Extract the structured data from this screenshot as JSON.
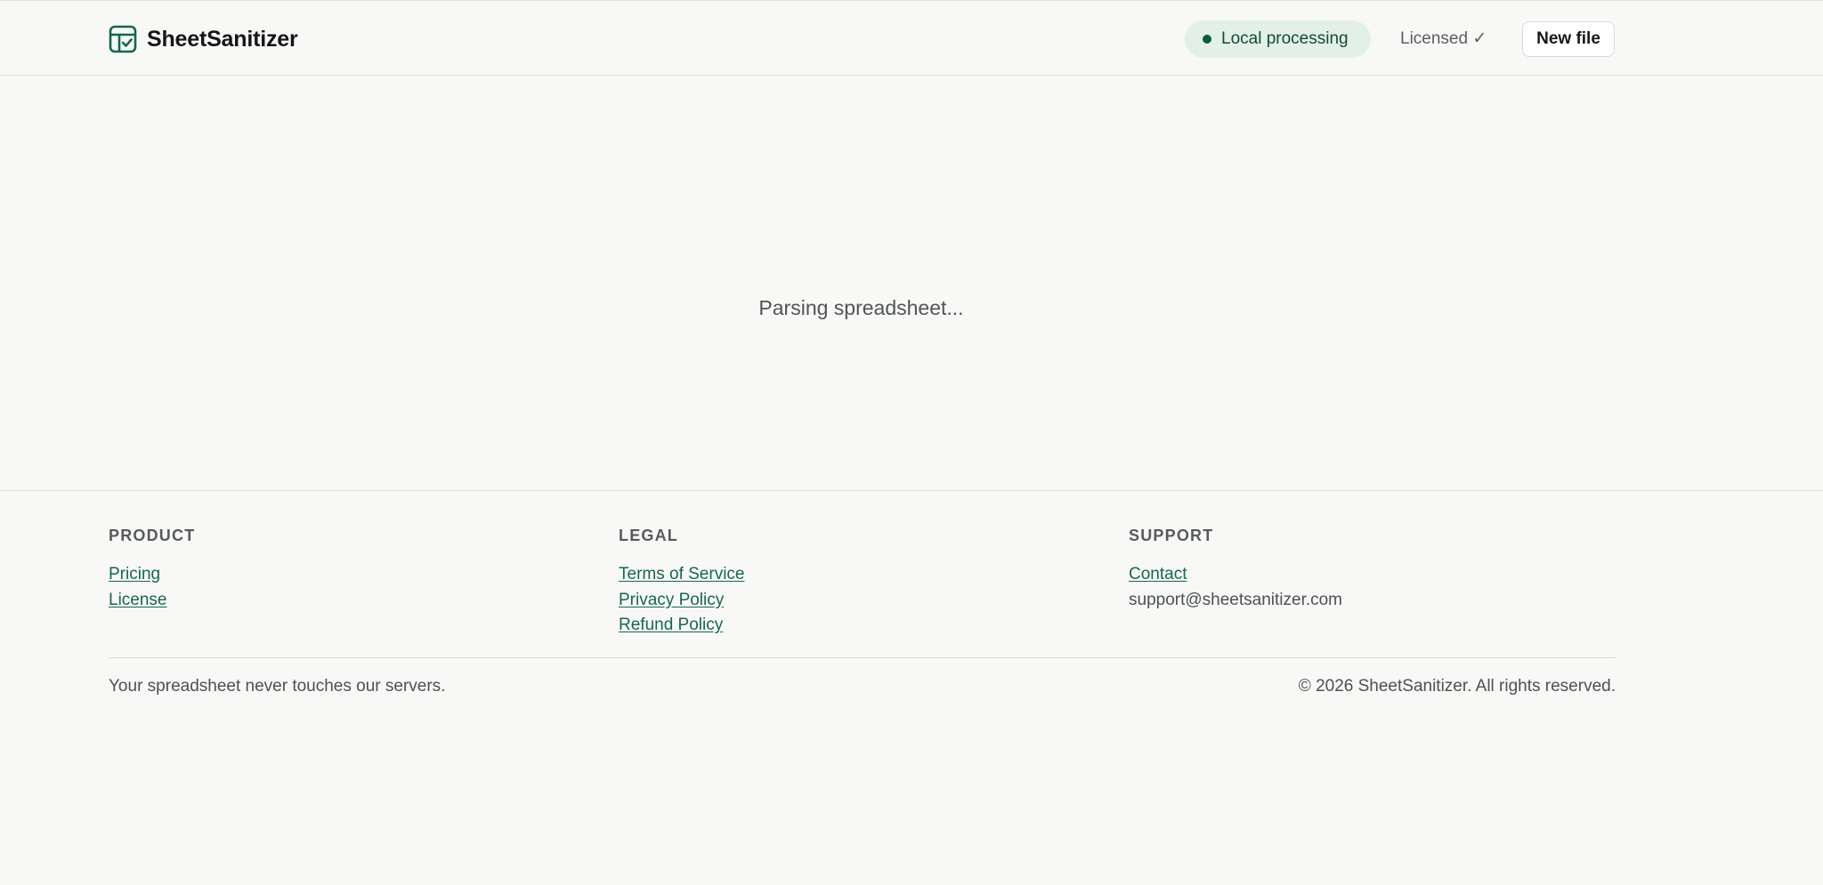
{
  "header": {
    "brand_name": "SheetSanitizer",
    "logo_icon": "spreadsheet-check-icon",
    "badge_label": "Local processing",
    "badge_dot_color": "#0c5a3c",
    "license_status": "Licensed ✓",
    "new_file_label": "New file"
  },
  "main": {
    "status_text": "Parsing spreadsheet..."
  },
  "footer": {
    "columns": [
      {
        "heading": "PRODUCT",
        "links": [
          "Pricing",
          "License"
        ]
      },
      {
        "heading": "LEGAL",
        "links": [
          "Terms of Service",
          "Privacy Policy",
          "Refund Policy"
        ]
      },
      {
        "heading": "SUPPORT",
        "links": [
          "Contact"
        ],
        "email": "support@sheetsanitizer.com"
      }
    ],
    "tagline": "Your spreadsheet never touches our servers.",
    "copyright": "© 2026 SheetSanitizer. All rights reserved."
  },
  "colors": {
    "accent": "#15684b",
    "badge_bg": "#e3efe9",
    "background": "#f8f8f7"
  }
}
